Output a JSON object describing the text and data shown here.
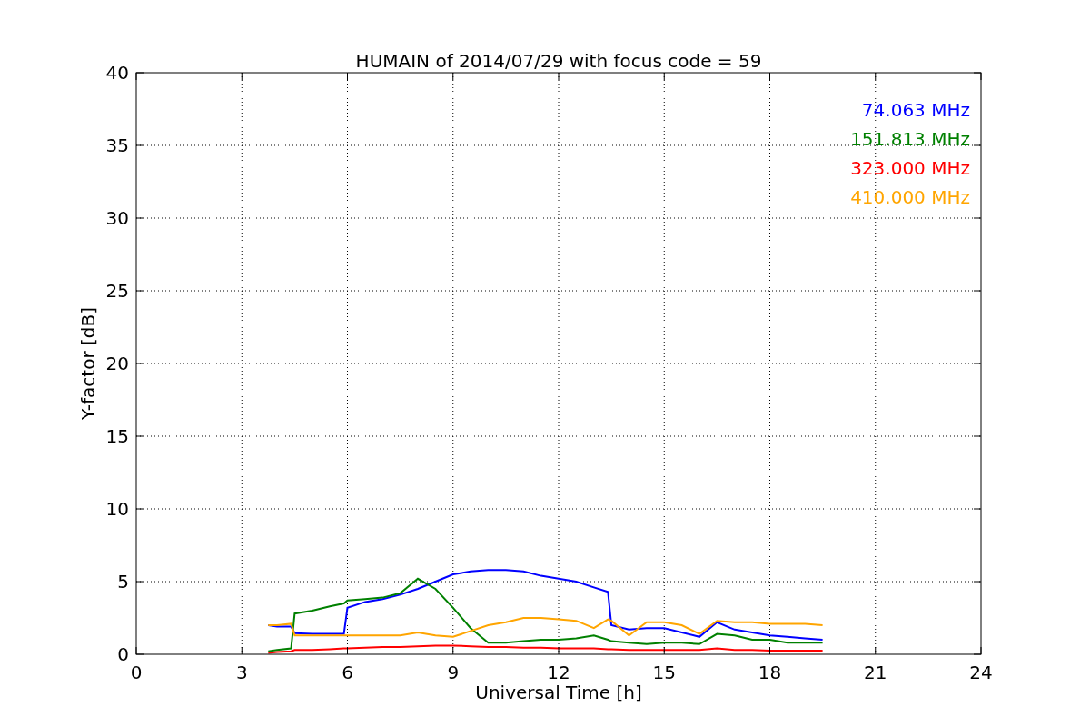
{
  "figure": {
    "chart_data": {
      "type": "line",
      "grid": true,
      "title": "HUMAIN of 2014/07/29 with focus code = 59",
      "xlabel": "Universal Time [h]",
      "ylabel": "Y-factor [dB]",
      "xlim": [
        0,
        24
      ],
      "ylim": [
        0,
        40
      ],
      "xticks": [
        0,
        3,
        6,
        9,
        12,
        15,
        18,
        21,
        24
      ],
      "yticks": [
        0,
        5,
        10,
        15,
        20,
        25,
        30,
        35,
        40
      ],
      "x": [
        3.75,
        4.0,
        4.4,
        4.5,
        5,
        5.5,
        5.9,
        6.0,
        6.5,
        7,
        7.5,
        8,
        8.5,
        9,
        9.5,
        10,
        10.5,
        11,
        11.5,
        12,
        12.5,
        13,
        13.4,
        13.5,
        14,
        14.5,
        15,
        15.5,
        16,
        16.5,
        17,
        17.5,
        18,
        18.5,
        19,
        19.5
      ],
      "series": [
        {
          "name": "74.063 MHz",
          "color": "#0000ff",
          "values": [
            2.0,
            1.9,
            1.9,
            1.45,
            1.4,
            1.4,
            1.4,
            3.2,
            3.6,
            3.8,
            4.1,
            4.5,
            5.0,
            5.5,
            5.7,
            5.8,
            5.8,
            5.7,
            5.4,
            5.2,
            5.0,
            4.6,
            4.3,
            2.0,
            1.7,
            1.8,
            1.8,
            1.5,
            1.2,
            2.2,
            1.7,
            1.5,
            1.3,
            1.2,
            1.1,
            1.0
          ]
        },
        {
          "name": "151.813 MHz",
          "color": "#008000",
          "values": [
            0.2,
            0.3,
            0.4,
            2.8,
            3.0,
            3.3,
            3.5,
            3.7,
            3.8,
            3.9,
            4.2,
            5.2,
            4.5,
            3.2,
            1.8,
            0.8,
            0.8,
            0.9,
            1.0,
            1.0,
            1.1,
            1.3,
            1.0,
            0.9,
            0.8,
            0.7,
            0.8,
            0.8,
            0.7,
            1.4,
            1.3,
            1.0,
            1.0,
            0.8,
            0.8,
            0.8
          ]
        },
        {
          "name": "323.000 MHz",
          "color": "#ff0000",
          "values": [
            0.1,
            0.15,
            0.2,
            0.3,
            0.3,
            0.35,
            0.4,
            0.4,
            0.45,
            0.5,
            0.5,
            0.55,
            0.6,
            0.6,
            0.55,
            0.5,
            0.5,
            0.45,
            0.45,
            0.4,
            0.4,
            0.4,
            0.35,
            0.35,
            0.3,
            0.3,
            0.3,
            0.3,
            0.3,
            0.4,
            0.3,
            0.3,
            0.25,
            0.25,
            0.25,
            0.25
          ]
        },
        {
          "name": "410.000 MHz",
          "color": "#ffa500",
          "values": [
            2.0,
            2.0,
            2.1,
            1.3,
            1.3,
            1.3,
            1.3,
            1.3,
            1.3,
            1.3,
            1.3,
            1.5,
            1.3,
            1.2,
            1.6,
            2.0,
            2.2,
            2.5,
            2.5,
            2.4,
            2.3,
            1.8,
            2.4,
            2.3,
            1.3,
            2.2,
            2.2,
            2.0,
            1.4,
            2.3,
            2.2,
            2.2,
            2.1,
            2.1,
            2.1,
            2.0
          ]
        }
      ]
    }
  }
}
